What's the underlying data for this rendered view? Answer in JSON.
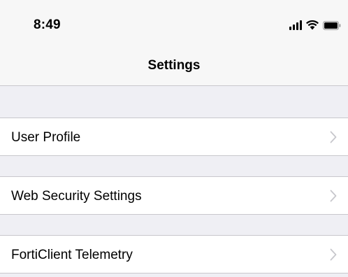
{
  "status_bar": {
    "time": "8:49",
    "signal_icon": "cellular-signal-icon",
    "wifi_icon": "wifi-icon",
    "battery_icon": "battery-icon"
  },
  "nav": {
    "title": "Settings"
  },
  "settings": {
    "items": [
      {
        "label": "User Profile",
        "icon": "chevron-right-icon"
      },
      {
        "label": "Web Security Settings",
        "icon": "chevron-right-icon"
      },
      {
        "label": "FortiClient Telemetry",
        "icon": "chevron-right-icon"
      }
    ]
  },
  "colors": {
    "background": "#efeff4",
    "cell": "#ffffff",
    "separator": "#c8c7cc",
    "chevron": "#c7c7cc",
    "bar": "#f7f7f7"
  }
}
